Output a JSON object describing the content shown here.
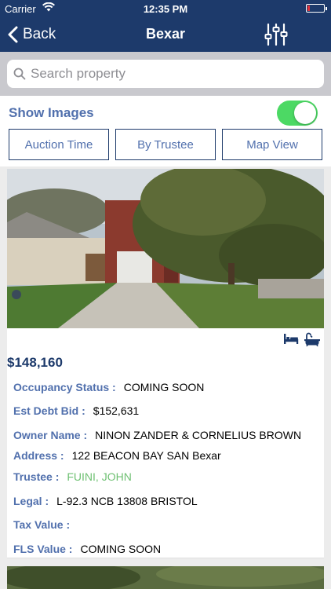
{
  "status_bar": {
    "carrier": "Carrier",
    "time": "12:35 PM"
  },
  "nav": {
    "back_label": "Back",
    "title": "Bexar",
    "filter_icon": "sliders-icon",
    "bar_color": "#1d3a6b"
  },
  "search": {
    "placeholder": "Search property",
    "value": ""
  },
  "controls": {
    "show_images_label": "Show Images",
    "show_images_on": true,
    "segments": [
      "Auction Time",
      "By Trustee",
      "Map View"
    ]
  },
  "listing": {
    "price": "$148,160",
    "amenity_icons": [
      "bed-icon",
      "bathtub-icon"
    ],
    "fields": {
      "occupancy": {
        "label": "Occupancy Status :",
        "value": "COMING SOON"
      },
      "debt": {
        "label": "Est Debt Bid :",
        "value": "$152,631"
      },
      "owner": {
        "label": "Owner Name :",
        "value": "NINON ZANDER & CORNELIUS BROWN"
      },
      "address": {
        "label": "Address :",
        "value": "122 BEACON BAY SAN Bexar"
      },
      "trustee": {
        "label": "Trustee :",
        "value": "FUINI, JOHN"
      },
      "legal": {
        "label": "Legal :",
        "value": "L-92.3 NCB 13808 BRISTOL"
      },
      "tax": {
        "label": "Tax Value :",
        "value": ""
      },
      "fls": {
        "label": "FLS Value :",
        "value": "COMING SOON"
      }
    }
  },
  "colors": {
    "accent": "#5170ad",
    "toggle_on": "#4cd964",
    "trustee_value": "#6ec072"
  }
}
